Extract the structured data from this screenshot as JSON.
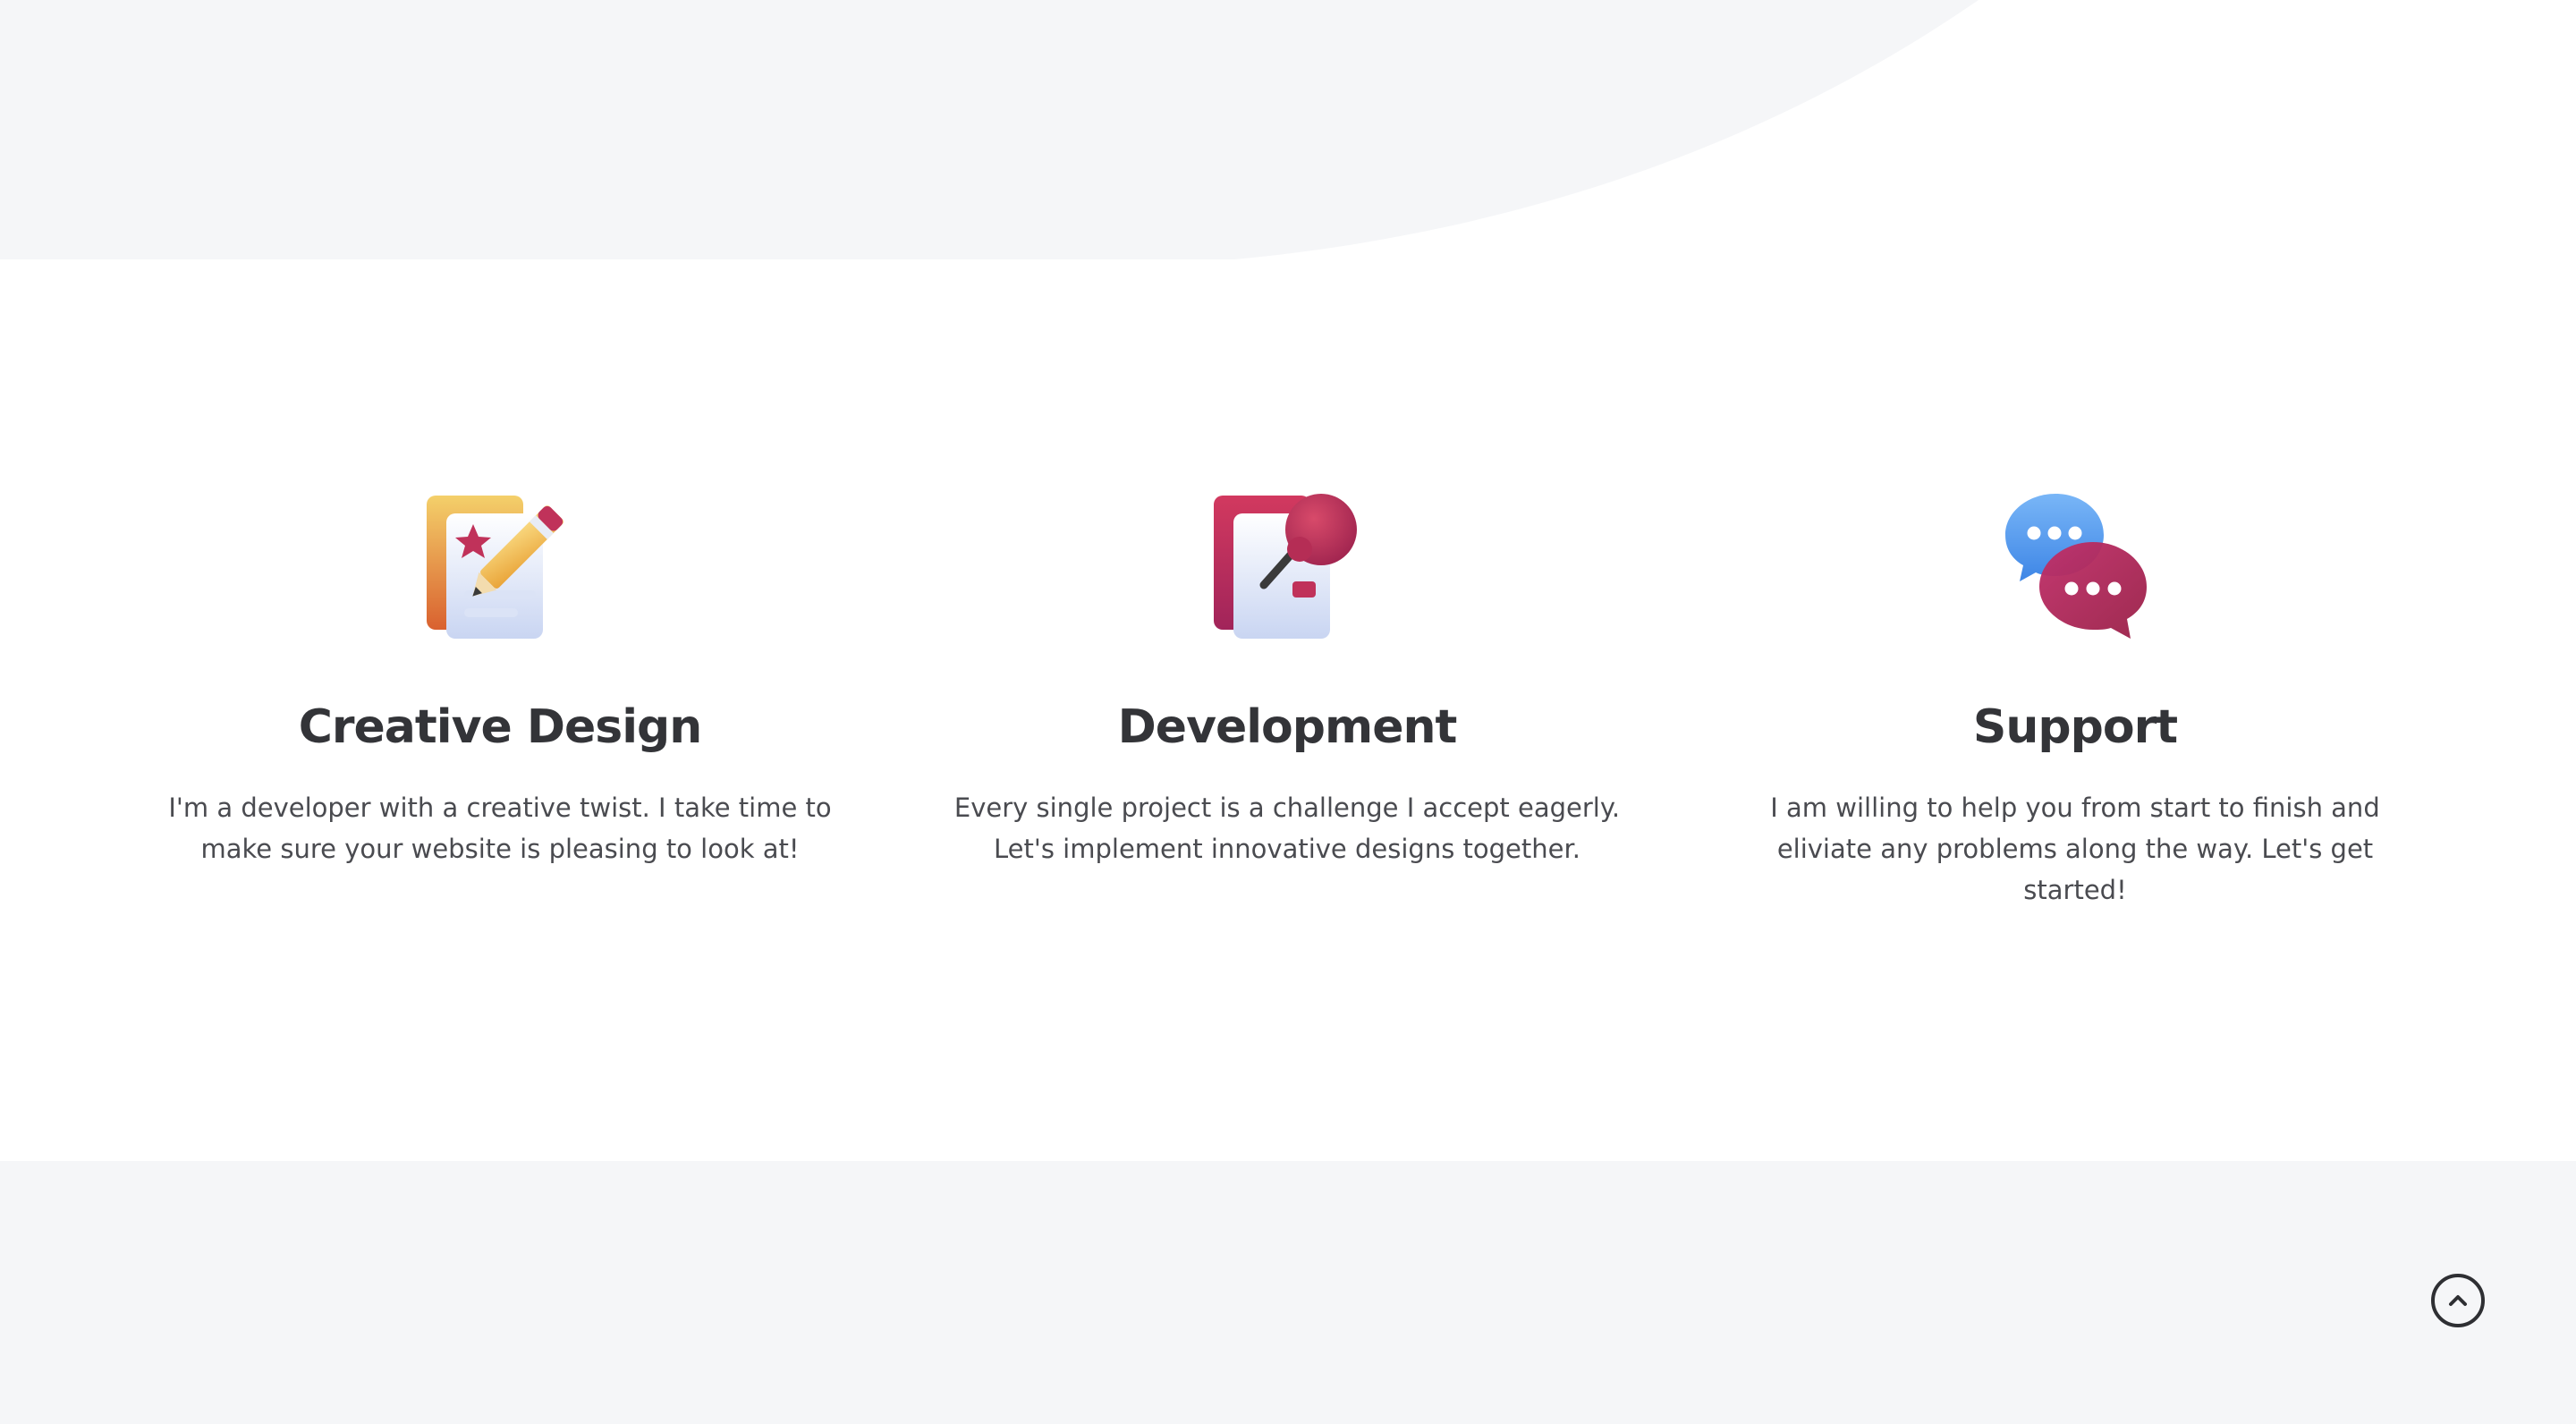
{
  "services": [
    {
      "icon": "design-document-pencil-icon",
      "title": "Creative Design",
      "description": "I'm a developer with a creative twist. I take time to make sure your website is pleasing to look at!"
    },
    {
      "icon": "development-document-pushpin-icon",
      "title": "Development",
      "description": "Every single project is a challenge I accept eagerly. Let's implement innovative designs together."
    },
    {
      "icon": "chat-bubbles-icon",
      "title": "Support",
      "description": "I am willing to help you from start to finish and eliviate any problems along the way. Let's get started!"
    }
  ],
  "back_to_top": {
    "icon": "chevron-up-circle-icon"
  },
  "colors": {
    "background": "#ffffff",
    "section_gray": "#f5f6f8",
    "heading": "#333438",
    "body_text": "#4a4b50",
    "accent_red": "#c0325a",
    "accent_yellow": "#f2c24f",
    "accent_blue": "#5aa0f0"
  }
}
